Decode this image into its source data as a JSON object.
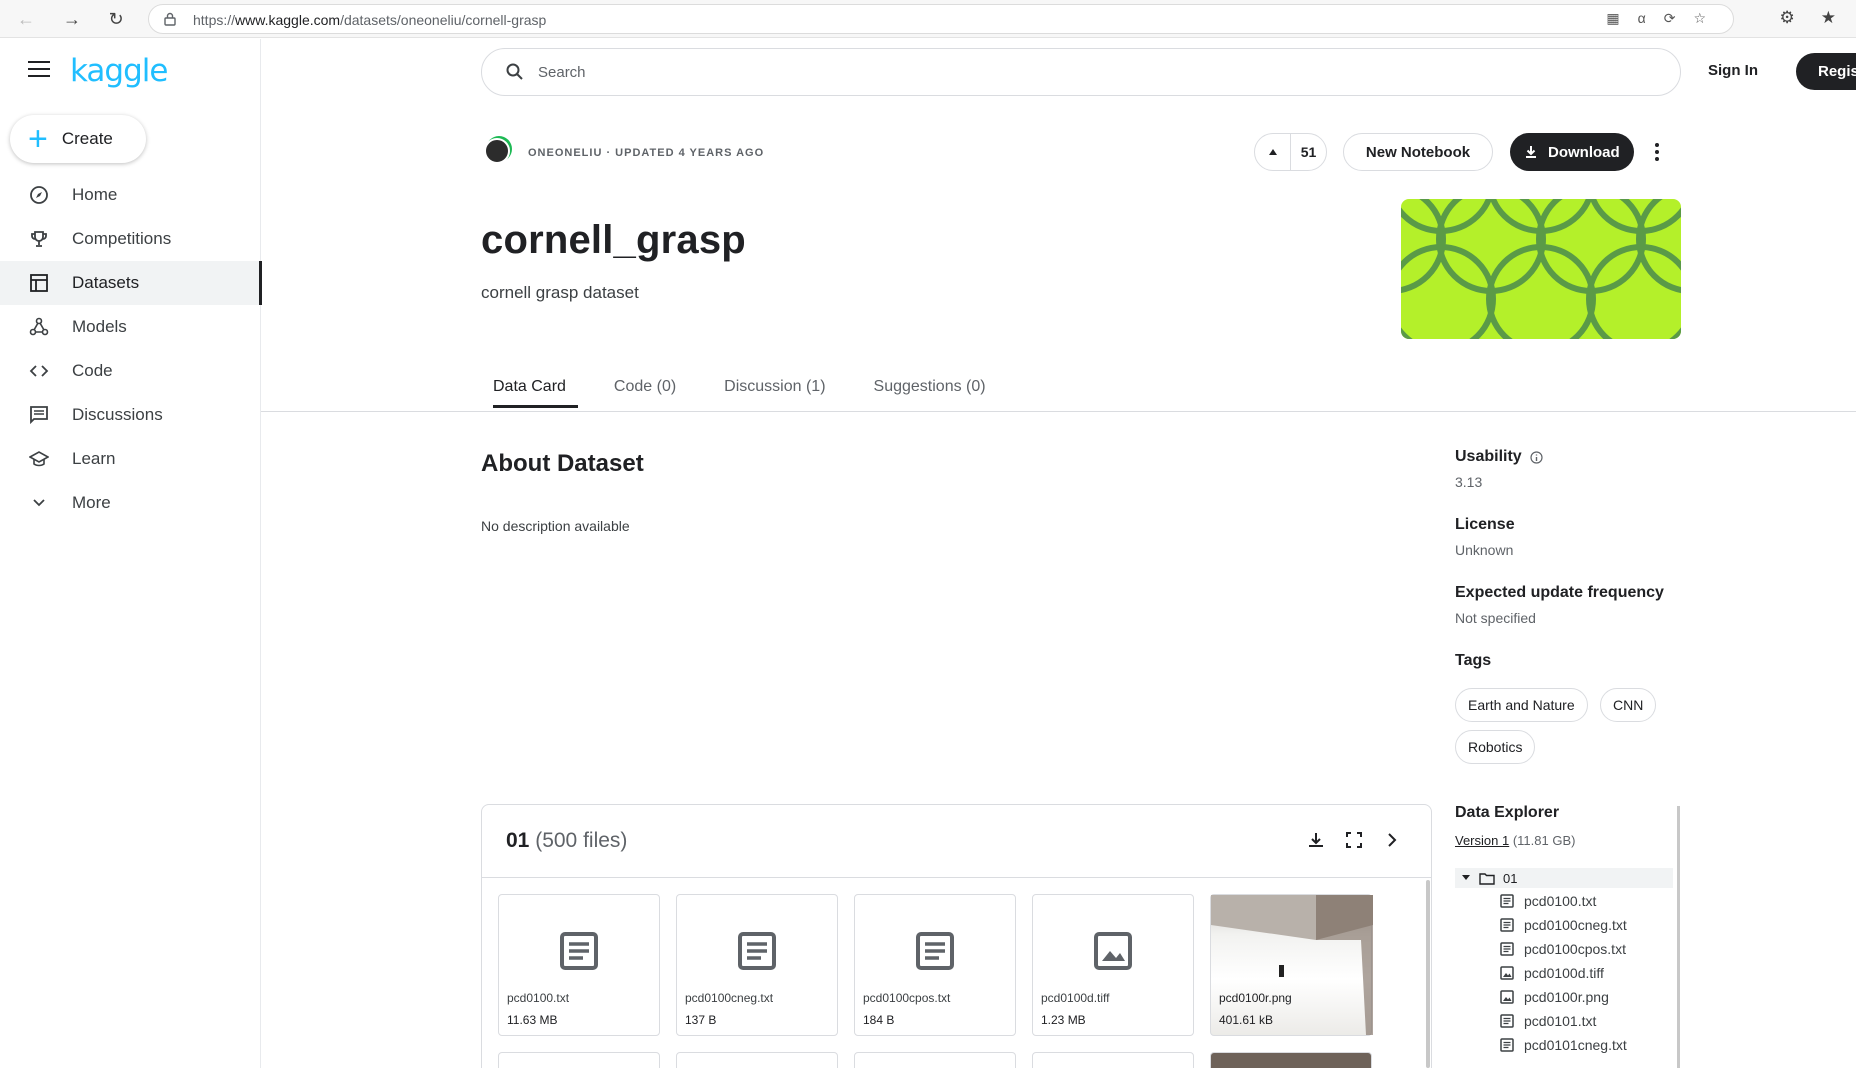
{
  "browser": {
    "url_prefix": "https://",
    "url_host": "www.kaggle.com",
    "url_path": "/datasets/oneoneliu/cornell-grasp"
  },
  "sidebar": {
    "logo": "kaggle",
    "create_label": "Create",
    "items": [
      {
        "label": "Home",
        "icon": "compass-icon"
      },
      {
        "label": "Competitions",
        "icon": "trophy-icon"
      },
      {
        "label": "Datasets",
        "icon": "table-icon",
        "active": true
      },
      {
        "label": "Models",
        "icon": "models-icon"
      },
      {
        "label": "Code",
        "icon": "code-icon"
      },
      {
        "label": "Discussions",
        "icon": "discussions-icon"
      },
      {
        "label": "Learn",
        "icon": "school-icon"
      },
      {
        "label": "More",
        "icon": "chevron-down-icon"
      }
    ]
  },
  "header": {
    "search_placeholder": "Search",
    "sign_in": "Sign In",
    "register": "Regis"
  },
  "dataset": {
    "owner_line": "ONEONELIU · UPDATED 4 YEARS AGO",
    "upvotes": "51",
    "new_notebook": "New Notebook",
    "download": "Download",
    "title": "cornell_grasp",
    "subtitle": "cornell grasp dataset",
    "banner_color": "#b4f02a"
  },
  "tabs": [
    "Data Card",
    "Code (0)",
    "Discussion (1)",
    "Suggestions (0)"
  ],
  "about": {
    "heading": "About Dataset",
    "description": "No description available"
  },
  "meta": {
    "usability_label": "Usability",
    "usability_value": "3.13",
    "license_label": "License",
    "license_value": "Unknown",
    "frequency_label": "Expected update frequency",
    "frequency_value": "Not specified",
    "tags_label": "Tags",
    "tags": [
      "Earth and Nature",
      "CNN",
      "Robotics"
    ]
  },
  "files": {
    "folder": "01",
    "count": "(500 files)",
    "tiles": [
      {
        "name": "pcd0100.txt",
        "size": "11.63 MB",
        "kind": "text"
      },
      {
        "name": "pcd0100cneg.txt",
        "size": "137 B",
        "kind": "text"
      },
      {
        "name": "pcd0100cpos.txt",
        "size": "184 B",
        "kind": "text"
      },
      {
        "name": "pcd0100d.tiff",
        "size": "1.23 MB",
        "kind": "image"
      },
      {
        "name": "pcd0100r.png",
        "size": "401.61 kB",
        "kind": "photo"
      }
    ]
  },
  "explorer": {
    "title": "Data Explorer",
    "version_link": "Version 1",
    "version_size": "(11.81 GB)",
    "root": "01",
    "items": [
      {
        "name": "pcd0100.txt",
        "kind": "text"
      },
      {
        "name": "pcd0100cneg.txt",
        "kind": "text"
      },
      {
        "name": "pcd0100cpos.txt",
        "kind": "text"
      },
      {
        "name": "pcd0100d.tiff",
        "kind": "image"
      },
      {
        "name": "pcd0100r.png",
        "kind": "image"
      },
      {
        "name": "pcd0101.txt",
        "kind": "text"
      },
      {
        "name": "pcd0101cneg.txt",
        "kind": "text"
      }
    ]
  }
}
